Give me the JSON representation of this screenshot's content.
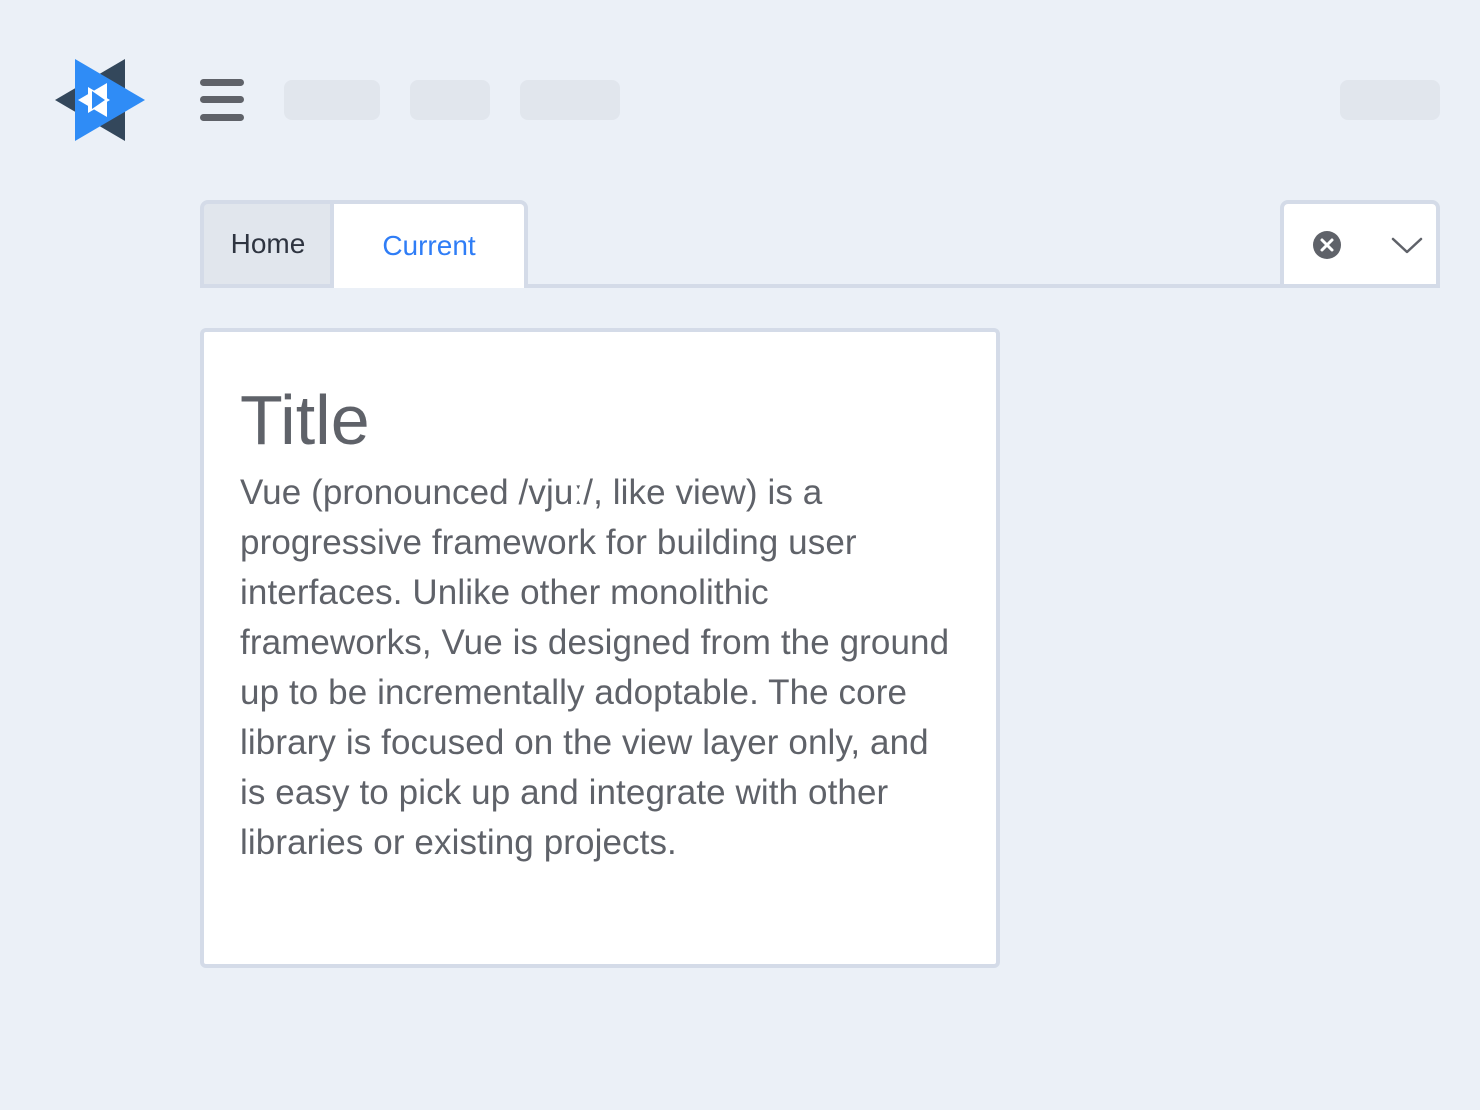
{
  "header": {
    "logo_icon": "vue-hexagram-logo",
    "menu_icon": "hamburger-menu-icon",
    "colors": {
      "logo_primary": "#2F8CF6",
      "logo_dark": "#33475B",
      "icon_gray": "#5F6269",
      "placeholder": "#E1E6ED"
    }
  },
  "tabs": {
    "home_label": "Home",
    "current_label": "Current",
    "active_color": "#2F7DF6",
    "close_icon": "close-circle-icon",
    "dropdown_icon": "chevron-down-icon"
  },
  "card": {
    "title": "Title",
    "body": "Vue (pronounced /vjuː/, like view) is a progressive framework for building user interfaces. Unlike other monolithic frameworks, Vue is designed from the ground up to be incrementally adoptable. The core library is focused on the view layer only, and is easy to pick up and integrate with other libraries or existing projects."
  }
}
